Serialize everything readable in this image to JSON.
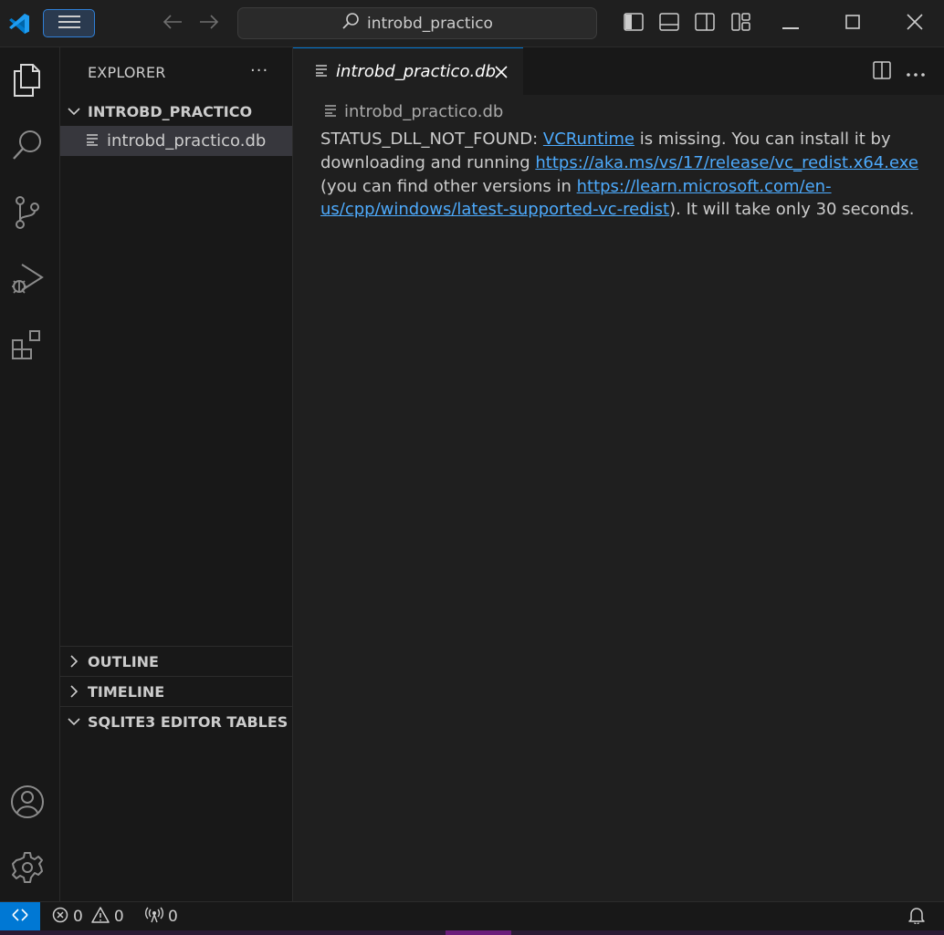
{
  "titlebar": {
    "search_text": "introbd_practico"
  },
  "sidebar": {
    "title": "EXPLORER",
    "more": "···",
    "folder": "INTROBD_PRACTICO",
    "file": "introbd_practico.db",
    "sections": [
      "OUTLINE",
      "TIMELINE",
      "SQLITE3 EDITOR TABLES"
    ]
  },
  "editor": {
    "tab_label": "introbd_practico.db",
    "breadcrumb": "introbd_practico.db",
    "message": {
      "prefix": "STATUS_DLL_NOT_FOUND: ",
      "link1": "VCRuntime",
      "mid1": " is missing. You can install it by downloading and running ",
      "link2": "https://aka.ms/vs/17/release/vc_redist.x64.exe",
      "mid2": " (you can find other versions in ",
      "link3": "https://learn.microsoft.com/en-us/cpp/windows/latest-supported-vc-redist",
      "suffix": "). It will take only 30 seconds."
    }
  },
  "statusbar": {
    "errors": "0",
    "warnings": "0",
    "ports": "0"
  },
  "colors": {
    "accent": "#0078d4",
    "link": "#4daafc",
    "background": "#1f1f1f",
    "sidebar_bg": "#181818"
  },
  "icons": {
    "activity": [
      "explorer-icon",
      "search-icon",
      "source-control-icon",
      "run-debug-icon",
      "extensions-icon",
      "account-icon",
      "settings-gear-icon"
    ]
  }
}
